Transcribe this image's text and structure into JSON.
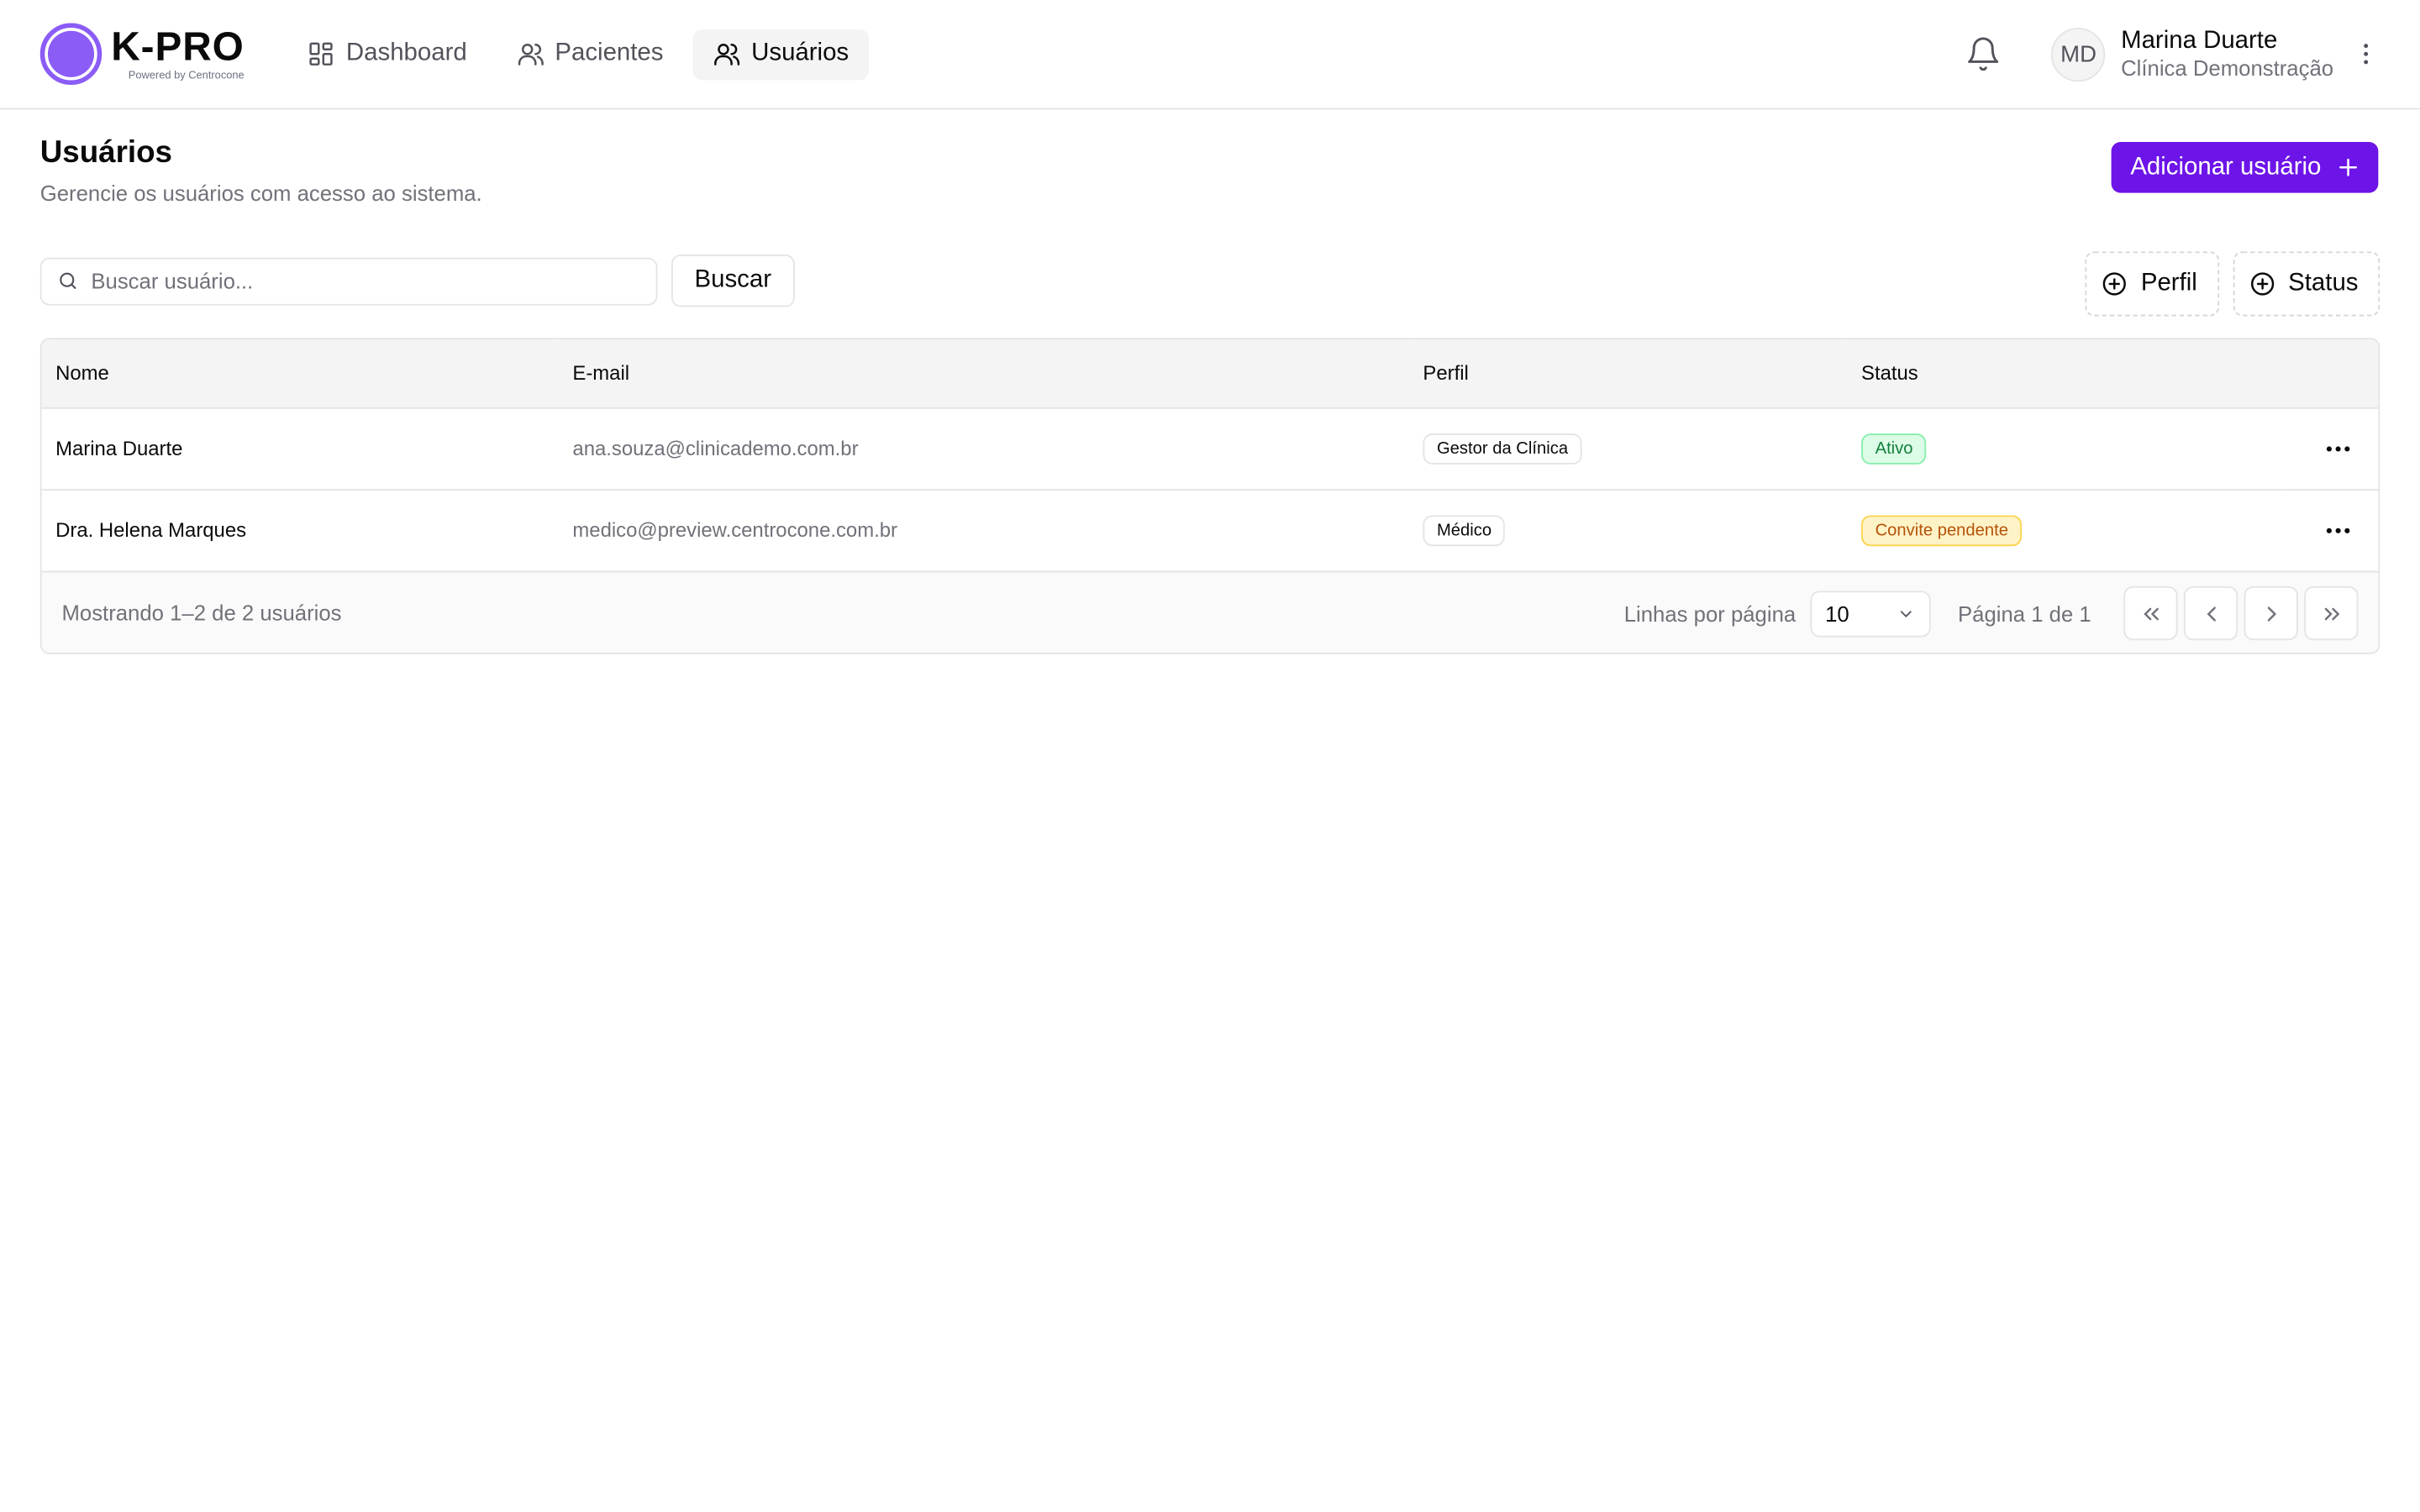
{
  "app": {
    "logo_title": "K-PRO",
    "logo_subtitle": "Powered by Centrocone",
    "brand_color": "#8b5cf6",
    "accent_color": "#6d14e8"
  },
  "nav": {
    "items": [
      {
        "label": "Dashboard",
        "icon": "dashboard-icon",
        "active": false
      },
      {
        "label": "Pacientes",
        "icon": "patients-icon",
        "active": false
      },
      {
        "label": "Usuários",
        "icon": "users-icon",
        "active": true
      }
    ]
  },
  "user": {
    "initials": "MD",
    "name": "Marina Duarte",
    "org": "Clínica Demonstração"
  },
  "page": {
    "title": "Usuários",
    "description": "Gerencie os usuários com acesso ao sistema.",
    "add_button": "Adicionar usuário"
  },
  "toolbar": {
    "search_placeholder": "Buscar usuário...",
    "search_button": "Buscar",
    "filter_profile": "Perfil",
    "filter_status": "Status"
  },
  "table": {
    "columns": [
      "Nome",
      "E-mail",
      "Perfil",
      "Status"
    ],
    "rows": [
      {
        "name": "Marina Duarte",
        "email": "ana.souza@clinicademo.com.br",
        "profile": "Gestor da Clínica",
        "status": "Ativo",
        "status_color": "#15803d"
      },
      {
        "name": "Dra. Helena Marques",
        "email": "medico@preview.centrocone.com.br",
        "profile": "Médico",
        "status": "Convite pendente",
        "status_color": "#b45309"
      }
    ],
    "footer": {
      "count_text": "Mostrando 1–2 de 2 usuários",
      "rows_per_page_label": "Linhas por página",
      "rows_per_page_value": "10",
      "page_text": "Página 1 de 1"
    }
  }
}
